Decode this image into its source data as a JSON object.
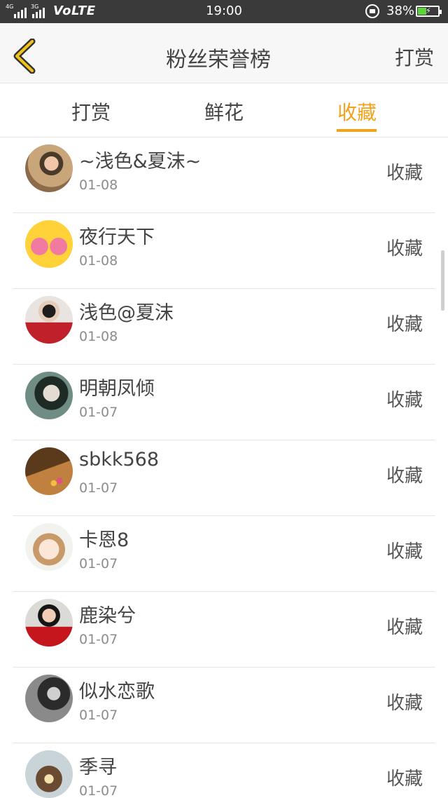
{
  "status_bar": {
    "network_left": "4G",
    "network_right": "3G",
    "volte": "VoLTE",
    "time": "19:00",
    "battery_percent": "38%"
  },
  "header": {
    "title": "粉丝荣誉榜",
    "right_action": "打赏"
  },
  "tabs": [
    {
      "label": "打赏",
      "active": false
    },
    {
      "label": "鲜花",
      "active": false
    },
    {
      "label": "收藏",
      "active": true
    }
  ],
  "accent_color": "#f2a21b",
  "fans": [
    {
      "name": "~浅色&夏沫~",
      "date": "01-08",
      "action": "收藏"
    },
    {
      "name": "夜行天下",
      "date": "01-08",
      "action": "收藏"
    },
    {
      "name": "浅色@夏沫",
      "date": "01-08",
      "action": "收藏"
    },
    {
      "name": "明朝凤倾",
      "date": "01-07",
      "action": "收藏"
    },
    {
      "name": "sbkk568",
      "date": "01-07",
      "action": "收藏"
    },
    {
      "name": "卡恩8",
      "date": "01-07",
      "action": "收藏"
    },
    {
      "name": "鹿染兮",
      "date": "01-07",
      "action": "收藏"
    },
    {
      "name": "似水恋歌",
      "date": "01-07",
      "action": "收藏"
    },
    {
      "name": "季寻",
      "date": "01-07",
      "action": "收藏"
    }
  ]
}
